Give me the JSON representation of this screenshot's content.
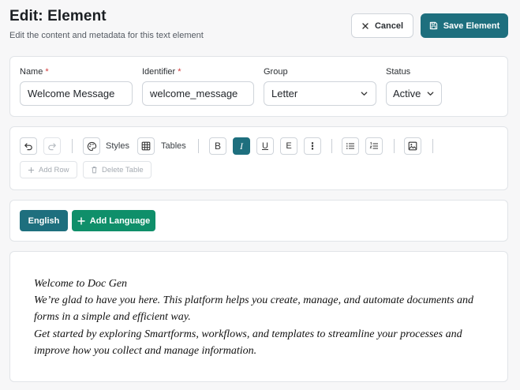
{
  "header": {
    "title": "Edit: Element",
    "subtitle": "Edit the content and metadata for this text element"
  },
  "actions": {
    "cancel_label": "Cancel",
    "save_label": "Save Element"
  },
  "meta": {
    "name": {
      "label": "Name",
      "required_mark": "*",
      "value": "Welcome Message"
    },
    "identifier": {
      "label": "Identifier",
      "required_mark": "*",
      "value": "welcome_message"
    },
    "group": {
      "label": "Group",
      "value": "Letter"
    },
    "status": {
      "label": "Status",
      "value": "Active"
    }
  },
  "toolbar": {
    "styles_label": "Styles",
    "tables_label": "Tables",
    "bold_glyph": "B",
    "italic_glyph": "I",
    "underline_glyph": "U",
    "strike_glyph": "E",
    "more_glyph": "⋮",
    "add_row_label": "Add Row",
    "delete_table_label": "Delete Table",
    "active_format": "italic"
  },
  "languages": {
    "current": "English",
    "add_label": "Add Language"
  },
  "editor": {
    "lines": [
      "Welcome to Doc Gen",
      "We’re glad to have you here. This platform helps you create, manage, and automate documents and forms in a simple and efficient way.",
      "Get started by exploring Smartforms, workflows, and templates to streamline your processes and improve how you collect and manage information."
    ]
  },
  "colors": {
    "primary": "#1e6f7e",
    "success": "#0f8f6a",
    "required": "#d23b3b"
  }
}
